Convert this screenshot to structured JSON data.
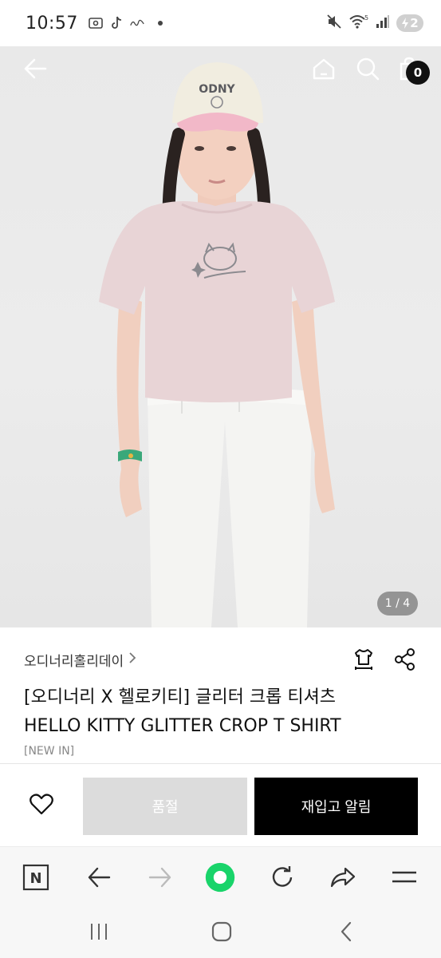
{
  "status_bar": {
    "time": "10:57",
    "battery_label": "2",
    "wifi_label": "5"
  },
  "header": {
    "cart_count": "0"
  },
  "hero": {
    "page_indicator": "1 / 4",
    "cap_text": "ODNY",
    "colors": {
      "background": "#ebebeb",
      "shirt": "#e8d4d6",
      "pants": "#f4f4f2",
      "cap": "#f1ede0",
      "cap_brim": "#f2b8c8"
    }
  },
  "product": {
    "brand": "오디너리홀리데이",
    "title_line1": "[오디너리 X 헬로키티] 글리터 크롭 티셔츠",
    "title_line2": "HELLO KITTY GLITTER CROP T SHIRT",
    "tag": "[NEW IN]"
  },
  "actions": {
    "soldout_label": "품절",
    "restock_label": "재입고 알림"
  },
  "browser_nav": {
    "n_label": "N"
  },
  "icons": [
    "back-icon",
    "home-icon",
    "search-icon",
    "shopping-bag-icon",
    "size-guide-icon",
    "share-icon",
    "heart-icon",
    "naver-n-icon",
    "arrow-left-icon",
    "arrow-right-icon",
    "green-dot-icon",
    "refresh-icon",
    "forward-share-icon",
    "menu-icon",
    "recents-icon",
    "home-button-icon",
    "back-button-icon"
  ]
}
